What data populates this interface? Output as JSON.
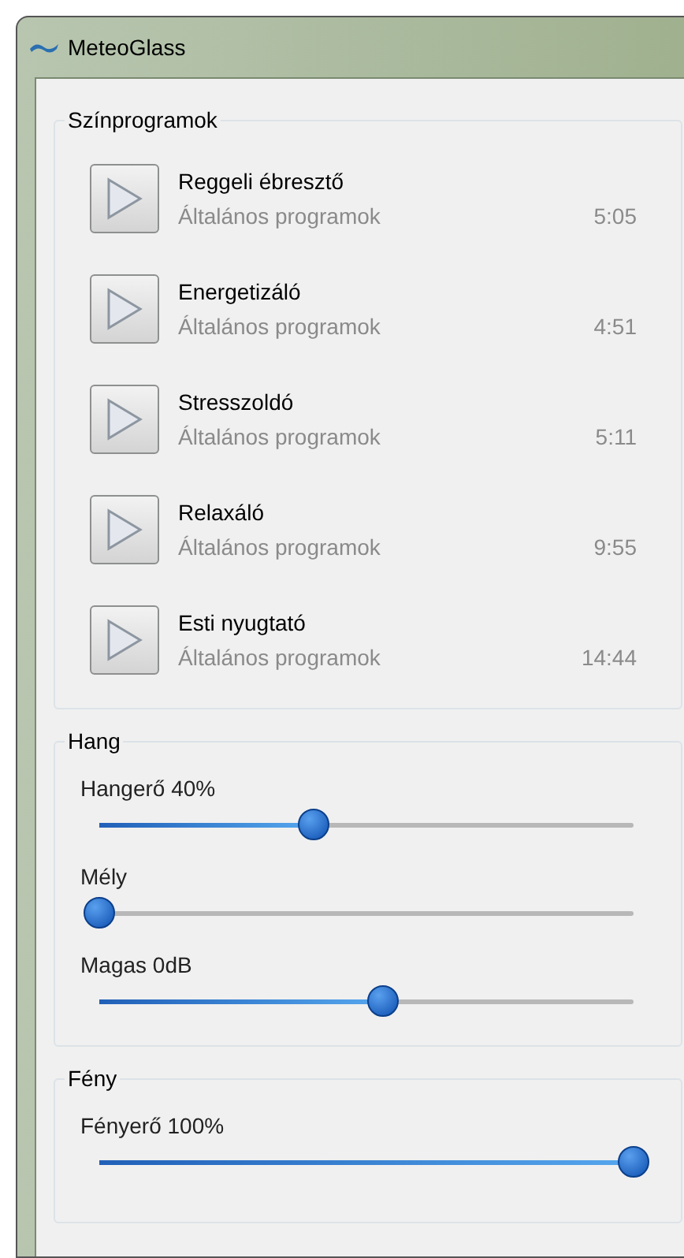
{
  "window": {
    "title": "MeteoGlass"
  },
  "programs": {
    "title": "Színprogramok",
    "items": [
      {
        "name": "Reggeli ébresztő",
        "category": "Általános programok",
        "duration": "5:05"
      },
      {
        "name": "Energetizáló",
        "category": "Általános programok",
        "duration": "4:51"
      },
      {
        "name": "Stresszoldó",
        "category": "Általános programok",
        "duration": "5:11"
      },
      {
        "name": "Relaxáló",
        "category": "Általános programok",
        "duration": "9:55"
      },
      {
        "name": "Esti nyugtató",
        "category": "Általános programok",
        "duration": "14:44"
      }
    ]
  },
  "sound": {
    "title": "Hang",
    "sliders": [
      {
        "label": "Hangerő 40%",
        "level": 0.4
      },
      {
        "label": "Mély",
        "level": 0
      },
      {
        "label": "Magas 0dB",
        "level": 0.53
      }
    ]
  },
  "light": {
    "title": "Fény",
    "sliders": [
      {
        "label": "Fényerő 100%",
        "level": 1
      }
    ]
  }
}
